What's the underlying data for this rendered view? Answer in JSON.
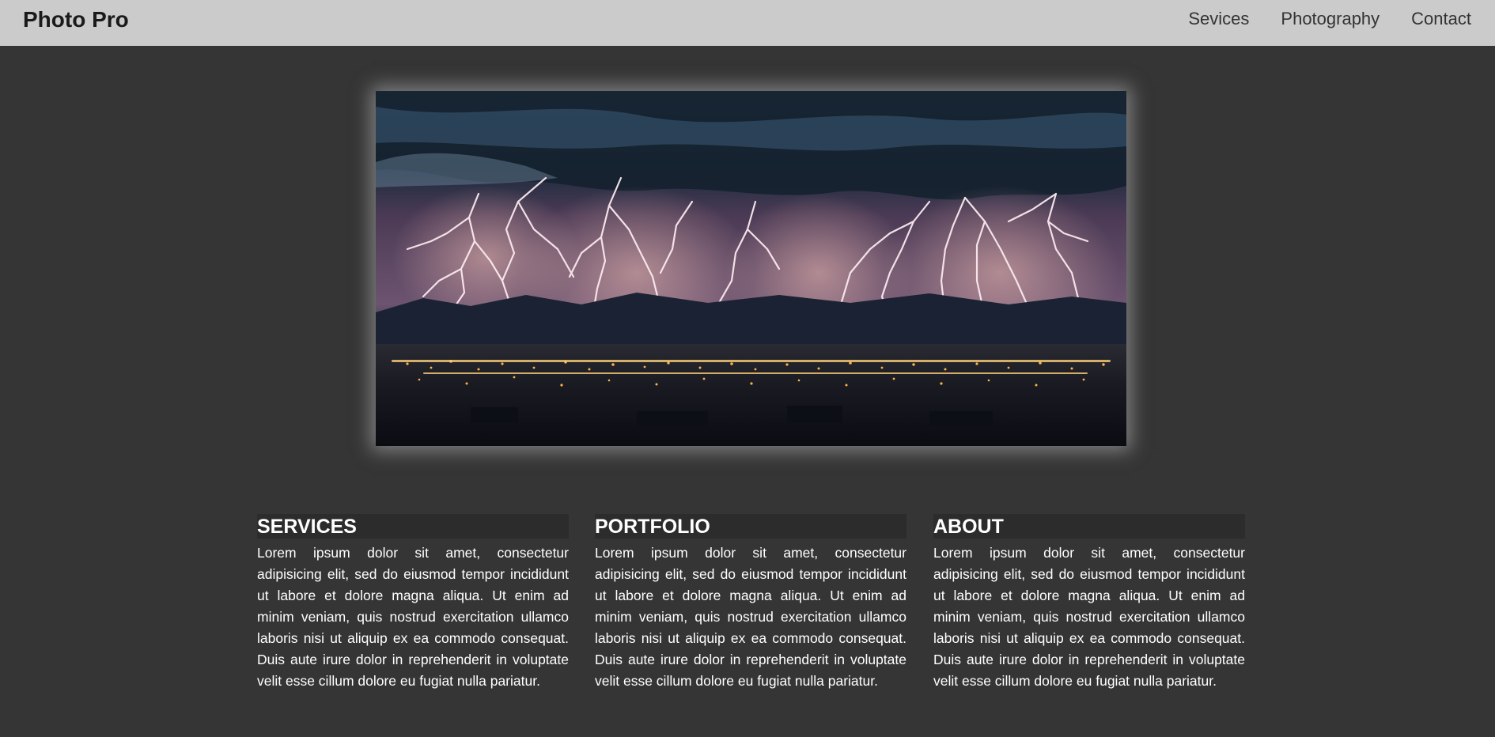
{
  "navbar": {
    "brand": "Photo Pro",
    "links": [
      "Sevices",
      "Photography",
      "Contact"
    ]
  },
  "hero": {
    "image_description_icon": "lightning-storm-image"
  },
  "sections": [
    {
      "heading": "SERVICES",
      "body": "Lorem ipsum dolor sit amet, consectetur adipisicing elit, sed do eiusmod tempor incididunt ut labore et dolore magna aliqua. Ut enim ad minim veniam, quis nostrud exercitation ullamco laboris nisi ut aliquip ex ea commodo consequat. Duis aute irure dolor in reprehenderit in voluptate velit esse cillum dolore eu fugiat nulla pariatur."
    },
    {
      "heading": "PORTFOLIO",
      "body": "Lorem ipsum dolor sit amet, consectetur adipisicing elit, sed do eiusmod tempor incididunt ut labore et dolore magna aliqua. Ut enim ad minim veniam, quis nostrud exercitation ullamco laboris nisi ut aliquip ex ea commodo consequat. Duis aute irure dolor in reprehenderit in voluptate velit esse cillum dolore eu fugiat nulla pariatur."
    },
    {
      "heading": "ABOUT",
      "body": "Lorem ipsum dolor sit amet, consectetur adipisicing elit, sed do eiusmod tempor incididunt ut labore et dolore magna aliqua. Ut enim ad minim veniam, quis nostrud exercitation ullamco laboris nisi ut aliquip ex ea commodo consequat. Duis aute irure dolor in reprehenderit in voluptate velit esse cillum dolore eu fugiat nulla pariatur."
    }
  ],
  "colors": {
    "page_background": "#353535",
    "navbar_background": "#cbcbcb",
    "heading_background": "#2c2c2c",
    "text": "#ffffff"
  }
}
